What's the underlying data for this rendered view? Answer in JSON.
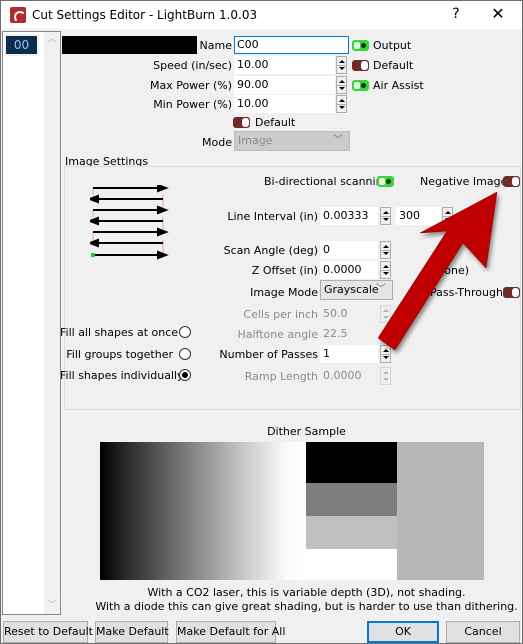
{
  "window": {
    "title": "Cut Settings Editor - LightBurn 1.0.03",
    "help_label": "?",
    "close_label": "✕"
  },
  "layer_list": {
    "selected": "00"
  },
  "general": {
    "name_label": "Name",
    "name_value": "C00",
    "speed_label": "Speed (in/sec)",
    "speed_value": "10.00",
    "max_power_label": "Max Power (%)",
    "max_power_value": "90.00",
    "min_power_label": "Min Power (%)",
    "min_power_value": "10.00",
    "output_label": "Output",
    "output_on": true,
    "speed_default_label": "Default",
    "speed_default_on": false,
    "air_assist_label": "Air Assist",
    "air_assist_on": true,
    "default_label": "Default",
    "default_on": false,
    "mode_label": "Mode",
    "mode_value": "Image"
  },
  "image_settings": {
    "group_label": "Image Settings",
    "bidirectional_label": "Bi-directional scanning",
    "bidirectional_on": true,
    "negative_image_label": "Negative Image",
    "negative_image_on": false,
    "line_interval_label": "Line Interval (in)",
    "line_interval_value": "0.00333",
    "dpi_value": "300",
    "scan_angle_label": "Scan Angle (deg)",
    "scan_angle_value": "0",
    "z_offset_label": "Z Offset (in)",
    "z_offset_value": "0.0000",
    "z_offset_note": "(none)",
    "image_mode_label": "Image Mode",
    "image_mode_value": "Grayscale",
    "pass_through_label": "Pass-Through",
    "pass_through_on": false,
    "cells_per_inch_label": "Cells per inch",
    "cells_per_inch_value": "50.0",
    "halftone_angle_label": "Halftone angle",
    "halftone_angle_value": "22.5",
    "passes_label": "Number of Passes",
    "passes_value": "1",
    "ramp_length_label": "Ramp Length",
    "ramp_length_value": "0.0000",
    "fill_options": [
      {
        "label": "Fill all shapes at once",
        "checked": false
      },
      {
        "label": "Fill groups together",
        "checked": false
      },
      {
        "label": "Fill shapes individually",
        "checked": true
      }
    ]
  },
  "dither": {
    "title": "Dither Sample",
    "caption_line1": "With a CO2 laser, this is variable depth (3D), not shading.",
    "caption_line2": "With a diode this can give great shading, but is harder to use than dithering."
  },
  "buttons": {
    "reset": "Reset to Default",
    "make_default": "Make Default",
    "make_default_all": "Make Default for All",
    "ok": "OK",
    "cancel": "Cancel"
  },
  "colors": {
    "toggle_on": "#3ad13a",
    "toggle_off": "#6d2b2b",
    "annotation_arrow": "#c00000",
    "focus_accent": "#0078d7"
  }
}
